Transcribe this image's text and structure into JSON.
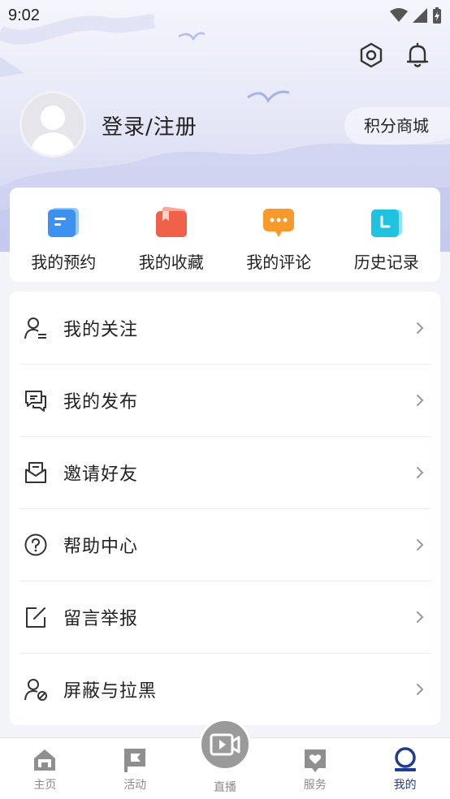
{
  "status_bar": {
    "time": "9:02"
  },
  "header": {
    "login_label": "登录/注册",
    "points_mall_label": "积分商城",
    "settings_icon": "hexagon-settings-icon",
    "bell_icon": "bell-icon"
  },
  "shortcuts": [
    {
      "label": "我的预约",
      "icon": "appointment-icon",
      "color": "#3d8ff0"
    },
    {
      "label": "我的收藏",
      "icon": "favorites-icon",
      "color": "#f0614a"
    },
    {
      "label": "我的评论",
      "icon": "comment-icon",
      "color": "#f79a2b"
    },
    {
      "label": "历史记录",
      "icon": "history-icon",
      "color": "#1fc2df"
    }
  ],
  "menu": [
    {
      "label": "我的关注",
      "icon": "user-follow-icon"
    },
    {
      "label": "我的发布",
      "icon": "chat-bubbles-icon"
    },
    {
      "label": "邀请好友",
      "icon": "invite-mail-icon"
    },
    {
      "label": "帮助中心",
      "icon": "help-circle-icon"
    },
    {
      "label": "留言举报",
      "icon": "edit-report-icon"
    },
    {
      "label": "屏蔽与拉黑",
      "icon": "user-block-icon"
    }
  ],
  "tabs": [
    {
      "label": "主页",
      "icon": "home-icon",
      "active": false
    },
    {
      "label": "活动",
      "icon": "flag-icon",
      "active": false
    },
    {
      "label": "直播",
      "icon": "live-video-icon",
      "active": false
    },
    {
      "label": "服务",
      "icon": "service-heart-icon",
      "active": false
    },
    {
      "label": "我的",
      "icon": "profile-icon",
      "active": true
    }
  ],
  "colors": {
    "accent": "#1f3c8f",
    "inactive_tab": "#8a8a8a",
    "live_button": "#9a9a9a"
  }
}
